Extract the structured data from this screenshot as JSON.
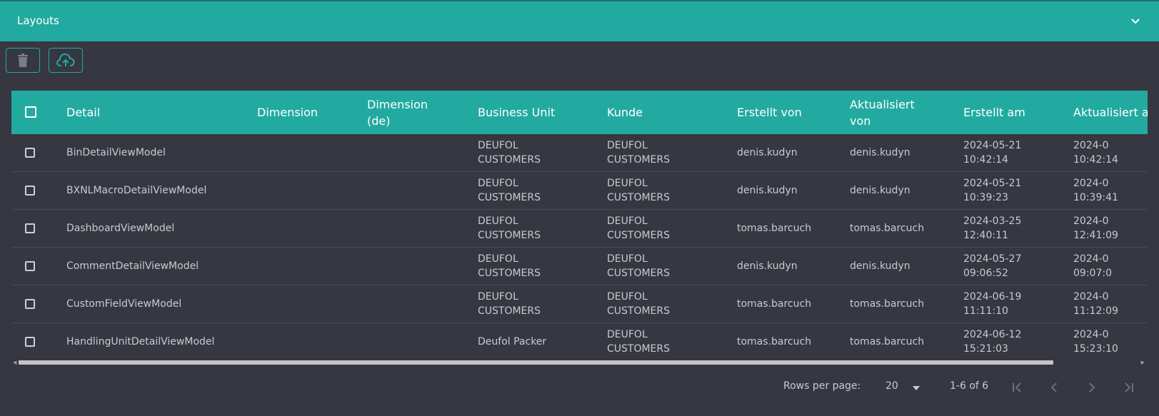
{
  "header": {
    "title": "Layouts",
    "collapse_icon": "chevron-down-icon"
  },
  "toolbar": {
    "delete_icon": "trash-icon",
    "upload_icon": "cloud-upload-icon"
  },
  "table": {
    "columns": [
      "Detail",
      "Dimension",
      "Dimension (de)",
      "Business Unit",
      "Kunde",
      "Erstellt von",
      "Aktualisiert von",
      "Erstellt am",
      "Aktualisiert am"
    ],
    "rows": [
      {
        "detail": "BinDetailViewModel",
        "dimension": "",
        "dimension_de": "",
        "business_unit": "DEUFOL CUSTOMERS",
        "kunde": "DEUFOL CUSTOMERS",
        "erstellt_von": "denis.kudyn",
        "aktualisiert_von": "denis.kudyn",
        "erstellt_am_date": "2024-05-21",
        "erstellt_am_time": "10:42:14",
        "aktualisiert_am_date": "2024-0",
        "aktualisiert_am_time": "10:42:14"
      },
      {
        "detail": "BXNLMacroDetailViewModel",
        "dimension": "",
        "dimension_de": "",
        "business_unit": "DEUFOL CUSTOMERS",
        "kunde": "DEUFOL CUSTOMERS",
        "erstellt_von": "denis.kudyn",
        "aktualisiert_von": "denis.kudyn",
        "erstellt_am_date": "2024-05-21",
        "erstellt_am_time": "10:39:23",
        "aktualisiert_am_date": "2024-0",
        "aktualisiert_am_time": "10:39:41"
      },
      {
        "detail": "DashboardViewModel",
        "dimension": "",
        "dimension_de": "",
        "business_unit": "DEUFOL CUSTOMERS",
        "kunde": "DEUFOL CUSTOMERS",
        "erstellt_von": "tomas.barcuch",
        "aktualisiert_von": "tomas.barcuch",
        "erstellt_am_date": "2024-03-25",
        "erstellt_am_time": "12:40:11",
        "aktualisiert_am_date": "2024-0",
        "aktualisiert_am_time": "12:41:09"
      },
      {
        "detail": "CommentDetailViewModel",
        "dimension": "",
        "dimension_de": "",
        "business_unit": "DEUFOL CUSTOMERS",
        "kunde": "DEUFOL CUSTOMERS",
        "erstellt_von": "denis.kudyn",
        "aktualisiert_von": "denis.kudyn",
        "erstellt_am_date": "2024-05-27",
        "erstellt_am_time": "09:06:52",
        "aktualisiert_am_date": "2024-0",
        "aktualisiert_am_time": "09:07:0"
      },
      {
        "detail": "CustomFieldViewModel",
        "dimension": "",
        "dimension_de": "",
        "business_unit": "DEUFOL CUSTOMERS",
        "kunde": "DEUFOL CUSTOMERS",
        "erstellt_von": "tomas.barcuch",
        "aktualisiert_von": "tomas.barcuch",
        "erstellt_am_date": "2024-06-19",
        "erstellt_am_time": "11:11:10",
        "aktualisiert_am_date": "2024-0",
        "aktualisiert_am_time": "11:12:09"
      },
      {
        "detail": "HandlingUnitDetailViewModel",
        "dimension": "",
        "dimension_de": "",
        "business_unit": "Deufol Packer",
        "kunde": "DEUFOL CUSTOMERS",
        "erstellt_von": "tomas.barcuch",
        "aktualisiert_von": "tomas.barcuch",
        "erstellt_am_date": "2024-06-12",
        "erstellt_am_time": "15:21:03",
        "aktualisiert_am_date": "2024-0",
        "aktualisiert_am_time": "15:23:10"
      }
    ]
  },
  "pagination": {
    "rows_per_page_label": "Rows per page:",
    "rows_per_page_value": "20",
    "range_text": "1-6 of 6",
    "icons": [
      "first-page-icon",
      "previous-page-icon",
      "next-page-icon",
      "last-page-icon"
    ]
  },
  "colors": {
    "accent": "#22aaa0",
    "background": "#363740",
    "text": "#c9cad0",
    "row_divider": "#4a4b55"
  }
}
